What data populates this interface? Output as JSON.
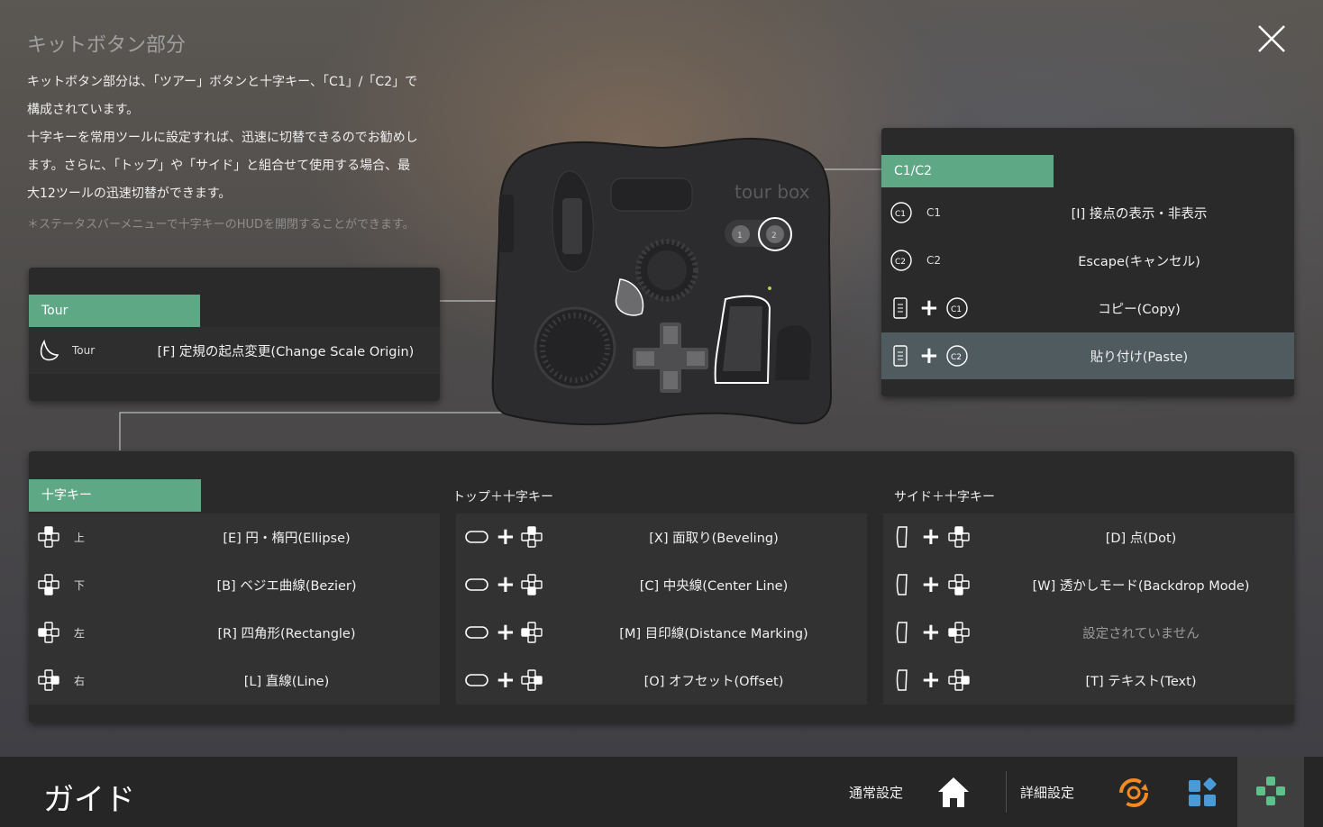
{
  "intro": {
    "title": "キットボタン部分",
    "body": "キットボタン部分は、「ツアー」ボタンと十字キー、「C1」/「C2」で\n構成されています。\n十字キーを常用ツールに設定すれば、迅速に切替できるのでお勧めし\nます。さらに、「トップ」や「サイド」と組合せて使用する場合、最\n大12ツールの迅速切替ができます。",
    "note": "＊ステータスバーメニューで十字キーのHUDを開閉することができます。"
  },
  "tour_panel": {
    "tag": "Tour",
    "row": {
      "label": "Tour",
      "action": "[F] 定規の起点変更(Change Scale Origin)"
    }
  },
  "c1c2_panel": {
    "tag": "C1/C2",
    "rows": [
      {
        "label": "C1",
        "action": "[I] 接点の表示・非表示"
      },
      {
        "label": "C2",
        "action": "Escape(キャンセル)"
      },
      {
        "action": "コピー(Copy)"
      },
      {
        "action": "貼り付け(Paste)",
        "selected": true
      }
    ]
  },
  "dpad_panel": {
    "tag": "十字キー",
    "col2_title": "トップ＋十字キー",
    "col3_title": "サイド＋十字キー",
    "col1": [
      {
        "label": "上",
        "action": "[E] 円・楕円(Ellipse)"
      },
      {
        "label": "下",
        "action": "[B] ベジエ曲線(Bezier)"
      },
      {
        "label": "左",
        "action": "[R] 四角形(Rectangle)"
      },
      {
        "label": "右",
        "action": "[L] 直線(Line)"
      }
    ],
    "col2": [
      {
        "action": "[X] 面取り(Beveling)"
      },
      {
        "action": "[C] 中央線(Center Line)"
      },
      {
        "action": "[M] 目印線(Distance Marking)"
      },
      {
        "action": "[O] オフセット(Offset)"
      }
    ],
    "col3": [
      {
        "action": "[D] 点(Dot)"
      },
      {
        "action": "[W] 透かしモード(Backdrop Mode)"
      },
      {
        "action": "設定されていません",
        "unset": true
      },
      {
        "action": "[T] テキスト(Text)"
      }
    ]
  },
  "device": {
    "logo": "tour box",
    "c1_label": "1",
    "c2_label": "2"
  },
  "bottom": {
    "title": "ガイド",
    "nav": [
      {
        "label": "通常設定",
        "icon": "home-icon"
      },
      {
        "label": "詳細設定",
        "icon": "settings-sync-icon"
      },
      {
        "icon": "apps-icon"
      },
      {
        "icon": "gamepad-icon",
        "active": true
      }
    ]
  },
  "colors": {
    "accent_green": "#5ea886",
    "panel_bg": "#2a2a2a",
    "selected_row": "#4f5b5f",
    "orange": "#f08a24",
    "blue": "#4a9ad8"
  }
}
